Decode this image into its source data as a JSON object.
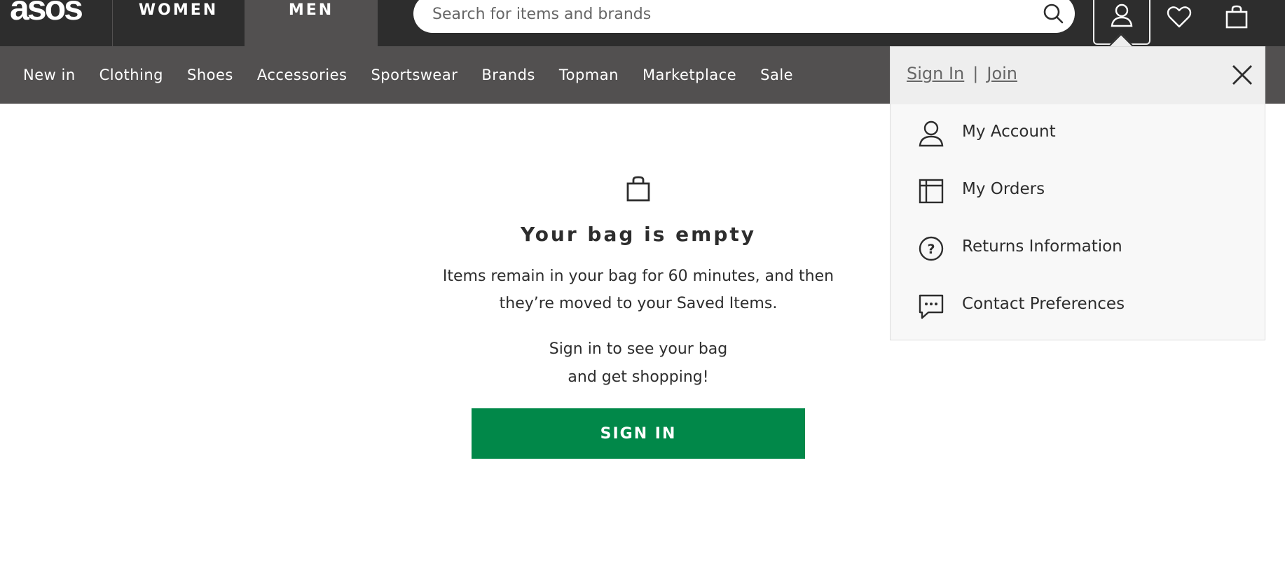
{
  "header": {
    "logo": "asos",
    "tabs": [
      {
        "label": "WOMEN"
      },
      {
        "label": "MEN",
        "active": true
      }
    ],
    "search": {
      "placeholder": "Search for items and brands",
      "value": ""
    },
    "icons": [
      "search-icon",
      "user-icon",
      "heart-icon",
      "bag-icon"
    ]
  },
  "nav": {
    "items": [
      "New in",
      "Clothing",
      "Shoes",
      "Accessories",
      "Sportswear",
      "Brands",
      "Topman",
      "Marketplace",
      "Sale"
    ]
  },
  "account_menu": {
    "sign_in": "Sign In",
    "separator": "|",
    "join": "Join",
    "items": [
      {
        "label": "My Account",
        "icon": "user-icon"
      },
      {
        "label": "My Orders",
        "icon": "box-icon"
      },
      {
        "label": "Returns Information",
        "icon": "question-circle-icon"
      },
      {
        "label": "Contact Preferences",
        "icon": "chat-bubble-icon"
      }
    ]
  },
  "bag": {
    "title": "Your bag is empty",
    "message_line1": "Items remain in your bag for 60 minutes, and then",
    "message_line2": "they’re moved to your Saved Items.",
    "prompt_line1": "Sign in to see your bag",
    "prompt_line2": "and get shopping!",
    "button": "SIGN IN"
  },
  "colors": {
    "topbar": "#2d2d2d",
    "nav": "#525050",
    "button_green": "#018849",
    "dropdown_bg": "#f8f8f8",
    "dropdown_header": "#eeeeee"
  }
}
